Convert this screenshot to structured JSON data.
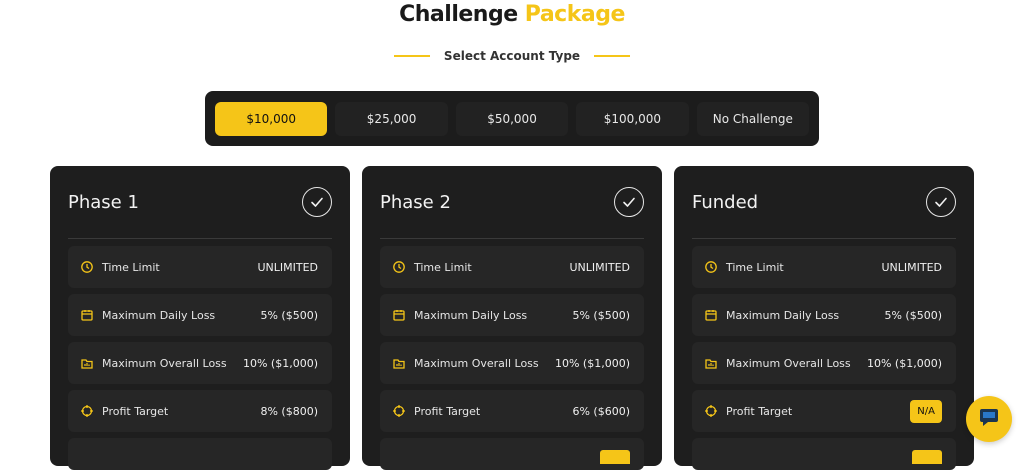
{
  "header": {
    "title_main": "Challenge",
    "title_accent": "Package",
    "subtitle": "Select Account Type",
    "accent_color": "#f5c518"
  },
  "account_tabs": [
    {
      "label": "$10,000",
      "active": true
    },
    {
      "label": "$25,000",
      "active": false
    },
    {
      "label": "$50,000",
      "active": false
    },
    {
      "label": "$100,000",
      "active": false
    },
    {
      "label": "No Challenge",
      "active": false
    }
  ],
  "cards": [
    {
      "title": "Phase 1",
      "check_icon": "checkmark-circle-icon",
      "rows": [
        {
          "icon": "history-clock-icon",
          "label": "Time Limit",
          "value": "UNLIMITED"
        },
        {
          "icon": "calendar-icon",
          "label": "Maximum Daily Loss",
          "value": "5% ($500)"
        },
        {
          "icon": "chart-folder-icon",
          "label": "Maximum Overall Loss",
          "value": "10% ($1,000)"
        },
        {
          "icon": "crosshair-icon",
          "label": "Profit Target",
          "value": "8% ($800)"
        }
      ]
    },
    {
      "title": "Phase 2",
      "check_icon": "checkmark-circle-icon",
      "rows": [
        {
          "icon": "history-clock-icon",
          "label": "Time Limit",
          "value": "UNLIMITED"
        },
        {
          "icon": "calendar-icon",
          "label": "Maximum Daily Loss",
          "value": "5% ($500)"
        },
        {
          "icon": "chart-folder-icon",
          "label": "Maximum Overall Loss",
          "value": "10% ($1,000)"
        },
        {
          "icon": "crosshair-icon",
          "label": "Profit Target",
          "value": "6% ($600)"
        }
      ]
    },
    {
      "title": "Funded",
      "check_icon": "checkmark-circle-icon",
      "rows": [
        {
          "icon": "history-clock-icon",
          "label": "Time Limit",
          "value": "UNLIMITED"
        },
        {
          "icon": "calendar-icon",
          "label": "Maximum Daily Loss",
          "value": "5% ($500)"
        },
        {
          "icon": "chart-folder-icon",
          "label": "Maximum Overall Loss",
          "value": "10% ($1,000)"
        },
        {
          "icon": "crosshair-icon",
          "label": "Profit Target",
          "value": "N/A",
          "badge": true
        }
      ]
    }
  ],
  "chat": {
    "icon": "chat-bubble-icon"
  }
}
